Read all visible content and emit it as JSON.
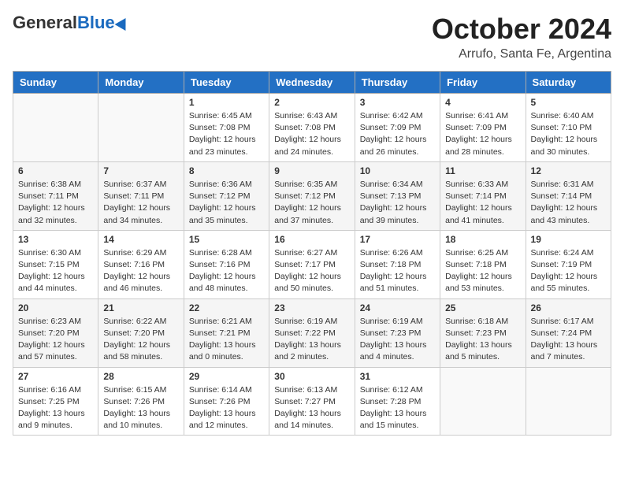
{
  "header": {
    "logo": {
      "general": "General",
      "blue": "Blue"
    },
    "title": "October 2024",
    "subtitle": "Arrufo, Santa Fe, Argentina"
  },
  "weekdays": [
    "Sunday",
    "Monday",
    "Tuesday",
    "Wednesday",
    "Thursday",
    "Friday",
    "Saturday"
  ],
  "weeks": [
    [
      {
        "day": "",
        "info": ""
      },
      {
        "day": "",
        "info": ""
      },
      {
        "day": "1",
        "info": "Sunrise: 6:45 AM\nSunset: 7:08 PM\nDaylight: 12 hours and 23 minutes."
      },
      {
        "day": "2",
        "info": "Sunrise: 6:43 AM\nSunset: 7:08 PM\nDaylight: 12 hours and 24 minutes."
      },
      {
        "day": "3",
        "info": "Sunrise: 6:42 AM\nSunset: 7:09 PM\nDaylight: 12 hours and 26 minutes."
      },
      {
        "day": "4",
        "info": "Sunrise: 6:41 AM\nSunset: 7:09 PM\nDaylight: 12 hours and 28 minutes."
      },
      {
        "day": "5",
        "info": "Sunrise: 6:40 AM\nSunset: 7:10 PM\nDaylight: 12 hours and 30 minutes."
      }
    ],
    [
      {
        "day": "6",
        "info": "Sunrise: 6:38 AM\nSunset: 7:11 PM\nDaylight: 12 hours and 32 minutes."
      },
      {
        "day": "7",
        "info": "Sunrise: 6:37 AM\nSunset: 7:11 PM\nDaylight: 12 hours and 34 minutes."
      },
      {
        "day": "8",
        "info": "Sunrise: 6:36 AM\nSunset: 7:12 PM\nDaylight: 12 hours and 35 minutes."
      },
      {
        "day": "9",
        "info": "Sunrise: 6:35 AM\nSunset: 7:12 PM\nDaylight: 12 hours and 37 minutes."
      },
      {
        "day": "10",
        "info": "Sunrise: 6:34 AM\nSunset: 7:13 PM\nDaylight: 12 hours and 39 minutes."
      },
      {
        "day": "11",
        "info": "Sunrise: 6:33 AM\nSunset: 7:14 PM\nDaylight: 12 hours and 41 minutes."
      },
      {
        "day": "12",
        "info": "Sunrise: 6:31 AM\nSunset: 7:14 PM\nDaylight: 12 hours and 43 minutes."
      }
    ],
    [
      {
        "day": "13",
        "info": "Sunrise: 6:30 AM\nSunset: 7:15 PM\nDaylight: 12 hours and 44 minutes."
      },
      {
        "day": "14",
        "info": "Sunrise: 6:29 AM\nSunset: 7:16 PM\nDaylight: 12 hours and 46 minutes."
      },
      {
        "day": "15",
        "info": "Sunrise: 6:28 AM\nSunset: 7:16 PM\nDaylight: 12 hours and 48 minutes."
      },
      {
        "day": "16",
        "info": "Sunrise: 6:27 AM\nSunset: 7:17 PM\nDaylight: 12 hours and 50 minutes."
      },
      {
        "day": "17",
        "info": "Sunrise: 6:26 AM\nSunset: 7:18 PM\nDaylight: 12 hours and 51 minutes."
      },
      {
        "day": "18",
        "info": "Sunrise: 6:25 AM\nSunset: 7:18 PM\nDaylight: 12 hours and 53 minutes."
      },
      {
        "day": "19",
        "info": "Sunrise: 6:24 AM\nSunset: 7:19 PM\nDaylight: 12 hours and 55 minutes."
      }
    ],
    [
      {
        "day": "20",
        "info": "Sunrise: 6:23 AM\nSunset: 7:20 PM\nDaylight: 12 hours and 57 minutes."
      },
      {
        "day": "21",
        "info": "Sunrise: 6:22 AM\nSunset: 7:20 PM\nDaylight: 12 hours and 58 minutes."
      },
      {
        "day": "22",
        "info": "Sunrise: 6:21 AM\nSunset: 7:21 PM\nDaylight: 13 hours and 0 minutes."
      },
      {
        "day": "23",
        "info": "Sunrise: 6:19 AM\nSunset: 7:22 PM\nDaylight: 13 hours and 2 minutes."
      },
      {
        "day": "24",
        "info": "Sunrise: 6:19 AM\nSunset: 7:23 PM\nDaylight: 13 hours and 4 minutes."
      },
      {
        "day": "25",
        "info": "Sunrise: 6:18 AM\nSunset: 7:23 PM\nDaylight: 13 hours and 5 minutes."
      },
      {
        "day": "26",
        "info": "Sunrise: 6:17 AM\nSunset: 7:24 PM\nDaylight: 13 hours and 7 minutes."
      }
    ],
    [
      {
        "day": "27",
        "info": "Sunrise: 6:16 AM\nSunset: 7:25 PM\nDaylight: 13 hours and 9 minutes."
      },
      {
        "day": "28",
        "info": "Sunrise: 6:15 AM\nSunset: 7:26 PM\nDaylight: 13 hours and 10 minutes."
      },
      {
        "day": "29",
        "info": "Sunrise: 6:14 AM\nSunset: 7:26 PM\nDaylight: 13 hours and 12 minutes."
      },
      {
        "day": "30",
        "info": "Sunrise: 6:13 AM\nSunset: 7:27 PM\nDaylight: 13 hours and 14 minutes."
      },
      {
        "day": "31",
        "info": "Sunrise: 6:12 AM\nSunset: 7:28 PM\nDaylight: 13 hours and 15 minutes."
      },
      {
        "day": "",
        "info": ""
      },
      {
        "day": "",
        "info": ""
      }
    ]
  ]
}
